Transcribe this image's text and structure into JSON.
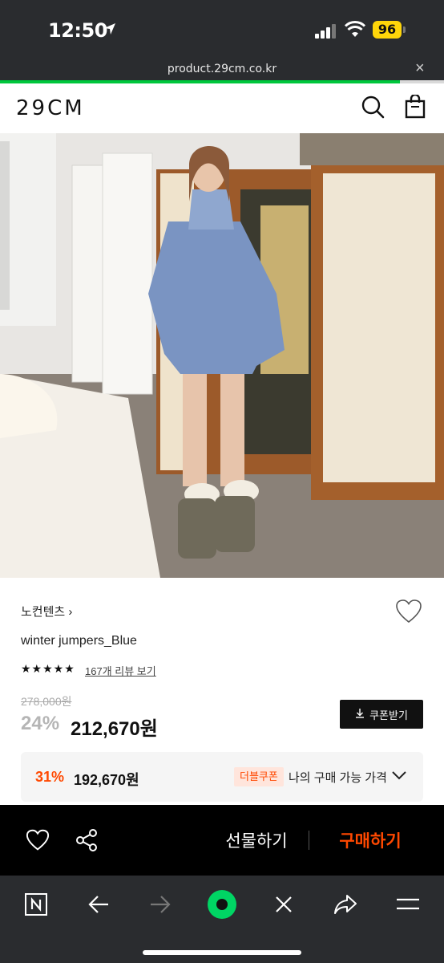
{
  "status_bar": {
    "time": "12:50",
    "battery": "96"
  },
  "browser": {
    "url": "product.29cm.co.kr",
    "close": "×",
    "load_progress": 0.9
  },
  "header": {
    "logo": "29CM",
    "search_icon": "search-icon",
    "bag_icon": "shopping-bag-icon"
  },
  "product": {
    "image_alt": "model wearing blue winter puffer jacket",
    "brand": "노컨텐츠 ›",
    "name": "winter jumpers_Blue",
    "rating_stars": "★★★★★",
    "rating_value": 5,
    "reviews": "167개 리뷰 보기",
    "original_price": "278,000원",
    "discount_rate": "24%",
    "sale_price": "212,670원",
    "coupon_button": "쿠폰받기"
  },
  "best_price": {
    "rate": "31%",
    "price": "192,670원",
    "badge": "더블쿠폰",
    "label": "나의 구매 가능 가격"
  },
  "buy_bar": {
    "gift": "선물하기",
    "purchase": "구매하기"
  },
  "colors": {
    "accent": "#ff4800",
    "naver_green": "#00c73c",
    "dark": "#2a2c2f"
  },
  "toolbar_icons": [
    "naver-n-icon",
    "back-arrow-icon",
    "forward-arrow-icon",
    "green-dot-icon",
    "close-x-icon",
    "share-arrow-icon",
    "menu-icon"
  ]
}
